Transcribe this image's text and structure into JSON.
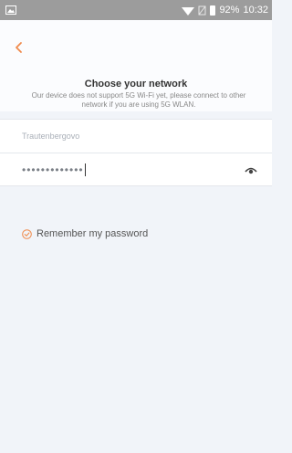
{
  "status": {
    "battery": "92%",
    "time": "10:32"
  },
  "page": {
    "title": "Choose your network",
    "description": "Our device does not support 5G Wi-Fi yet, please connect to other network if you are using 5G WLAN."
  },
  "form": {
    "ssid_value": "Trautenbergovo",
    "password_masked": "•••••••••••••",
    "remember_label": "Remember my password",
    "remember_checked": true
  },
  "colors": {
    "accent": "#f08a4b",
    "background": "#f1f4f9",
    "status_bar": "#9c9c9c"
  },
  "icons": {
    "back": "chevron-left-icon",
    "eye": "eye-icon",
    "check": "check-circle-icon",
    "wifi": "wifi-icon",
    "battery": "battery-icon",
    "image": "image-icon"
  }
}
